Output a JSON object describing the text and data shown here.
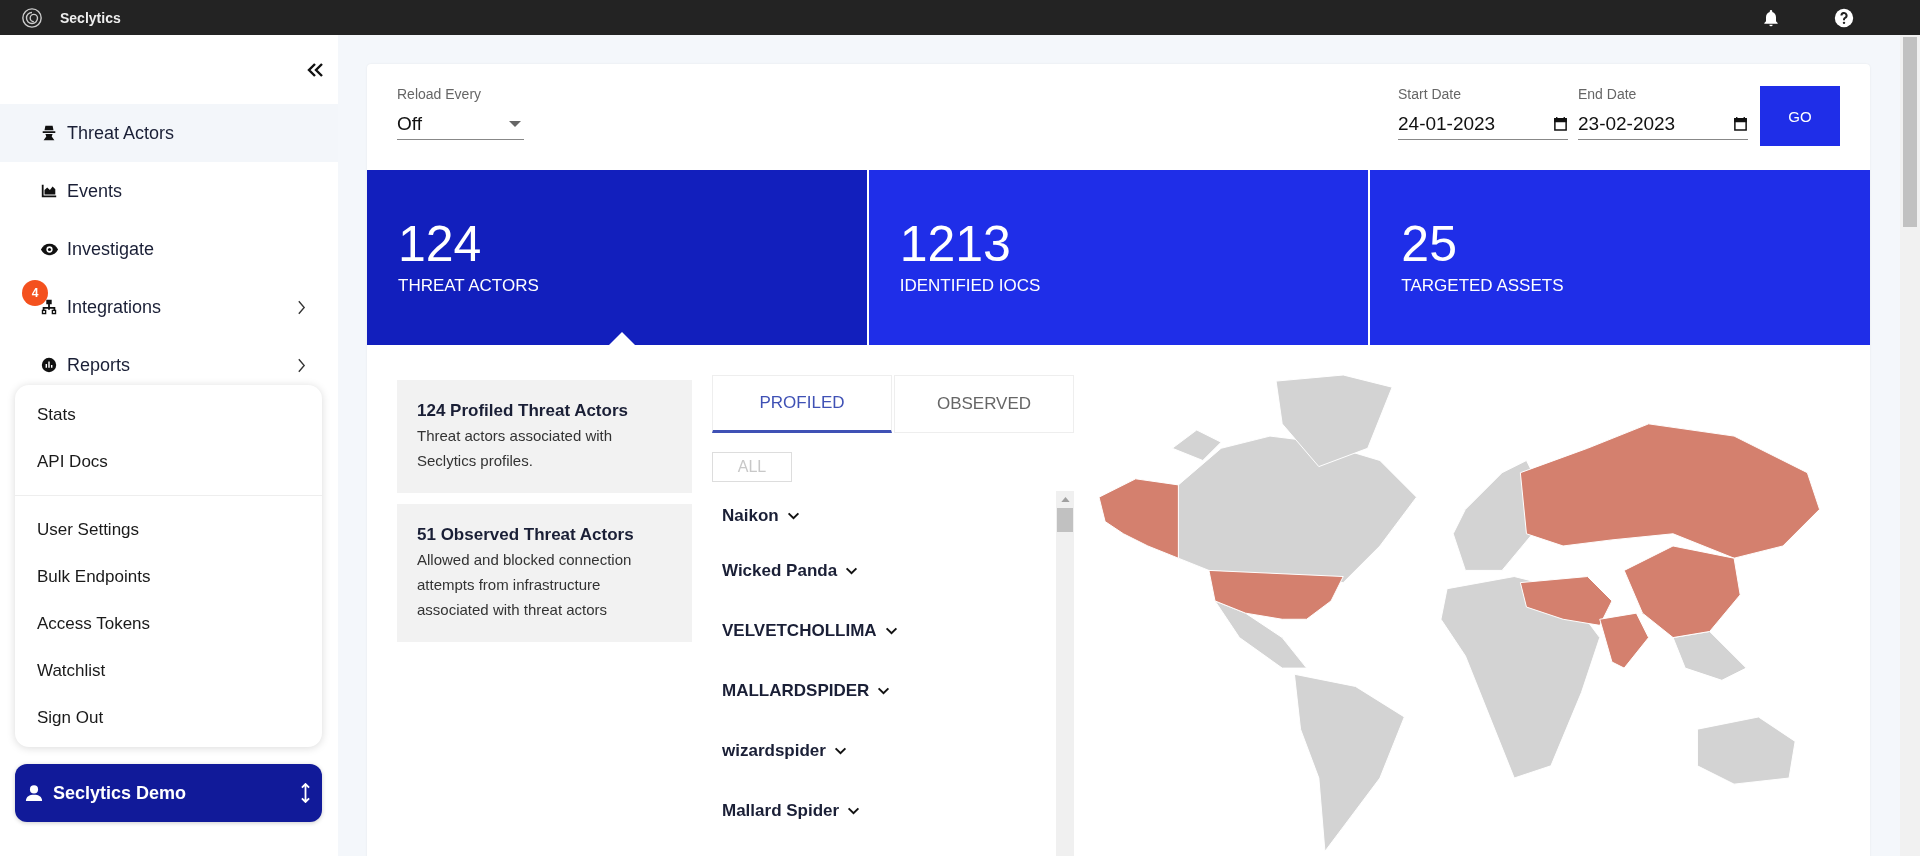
{
  "app": {
    "name": "Seclytics"
  },
  "sidebar": {
    "items": [
      {
        "label": "Threat Actors",
        "selected": true,
        "expandable": false
      },
      {
        "label": "Events",
        "selected": false,
        "expandable": false
      },
      {
        "label": "Investigate",
        "selected": false,
        "expandable": false
      },
      {
        "label": "Integrations",
        "selected": false,
        "expandable": true,
        "badge": "4"
      },
      {
        "label": "Reports",
        "selected": false,
        "expandable": true
      }
    ]
  },
  "user_menu": {
    "groups": [
      [
        {
          "label": "Stats"
        },
        {
          "label": "API Docs"
        }
      ],
      [
        {
          "label": "User Settings"
        },
        {
          "label": "Bulk Endpoints"
        },
        {
          "label": "Access Tokens"
        },
        {
          "label": "Watchlist"
        },
        {
          "label": "Sign Out"
        }
      ]
    ]
  },
  "account": {
    "name": "Seclytics Demo"
  },
  "filters": {
    "reload": {
      "label": "Reload Every",
      "value": "Off"
    },
    "start_date": {
      "label": "Start Date",
      "value": "24-01-2023"
    },
    "end_date": {
      "label": "End Date",
      "value": "23-02-2023"
    },
    "go_button": "GO"
  },
  "stats": [
    {
      "value": "124",
      "label": "THREAT ACTORS",
      "selected": true
    },
    {
      "value": "1213",
      "label": "IDENTIFIED IOCS",
      "selected": false
    },
    {
      "value": "25",
      "label": "TARGETED ASSETS",
      "selected": false
    }
  ],
  "info_cards": [
    {
      "title": "124 Profiled Threat Actors",
      "description": "Threat actors associated with Seclytics profiles."
    },
    {
      "title": "51 Observed Threat Actors",
      "description": "Allowed and blocked connection attempts from infrastructure associated with threat actors"
    }
  ],
  "tabs": [
    {
      "label": "PROFILED",
      "selected": true
    },
    {
      "label": "OBSERVED",
      "selected": false
    }
  ],
  "all_button": {
    "label": "ALL",
    "disabled": true
  },
  "actors": [
    {
      "name": "Naikon"
    },
    {
      "name": "Wicked Panda"
    },
    {
      "name": "VELVETCHOLLIMA"
    },
    {
      "name": "MALLARDSPIDER"
    },
    {
      "name": "wizardspider"
    },
    {
      "name": "Mallard Spider"
    }
  ]
}
